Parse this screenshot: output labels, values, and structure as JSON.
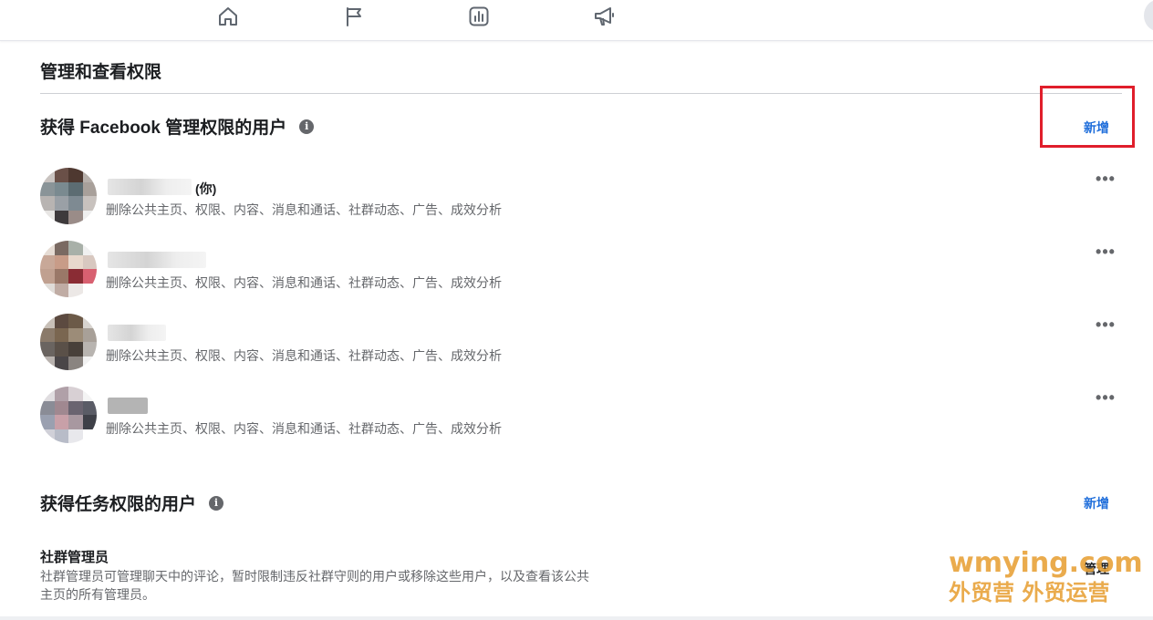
{
  "nav": {
    "icons": [
      "home-icon",
      "flag-icon",
      "insights-icon",
      "megaphone-icon"
    ]
  },
  "page": {
    "title": "管理和查看权限"
  },
  "facebook_access": {
    "title": "获得 Facebook 管理权限的用户",
    "add_label": "新增",
    "users": [
      {
        "name_suffix": "(你)",
        "permissions": "删除公共主页、权限、内容、消息和通话、社群动态、广告、成效分析"
      },
      {
        "name_suffix": "",
        "permissions": "删除公共主页、权限、内容、消息和通话、社群动态、广告、成效分析"
      },
      {
        "name_suffix": "",
        "permissions": "删除公共主页、权限、内容、消息和通话、社群动态、广告、成效分析"
      },
      {
        "name_suffix": "",
        "permissions": "删除公共主页、权限、内容、消息和通话、社群动态、广告、成效分析"
      }
    ],
    "more_label": "•••"
  },
  "task_access": {
    "title": "获得任务权限的用户",
    "add_label": "新增",
    "role": {
      "title": "社群管理员",
      "description": "社群管理员可管理聊天中的评论，暂时限制违反社群守则的用户或移除这些用户，以及查看该公共主页的所有管理员。",
      "manage_label": "管理"
    }
  },
  "watermark": {
    "line1": "wmying.com",
    "line2": "外贸营 外贸运营"
  },
  "colors": {
    "accent_blue": "#216fdb",
    "highlight_red": "#e01e2b",
    "watermark_orange": "#e8a33a"
  }
}
